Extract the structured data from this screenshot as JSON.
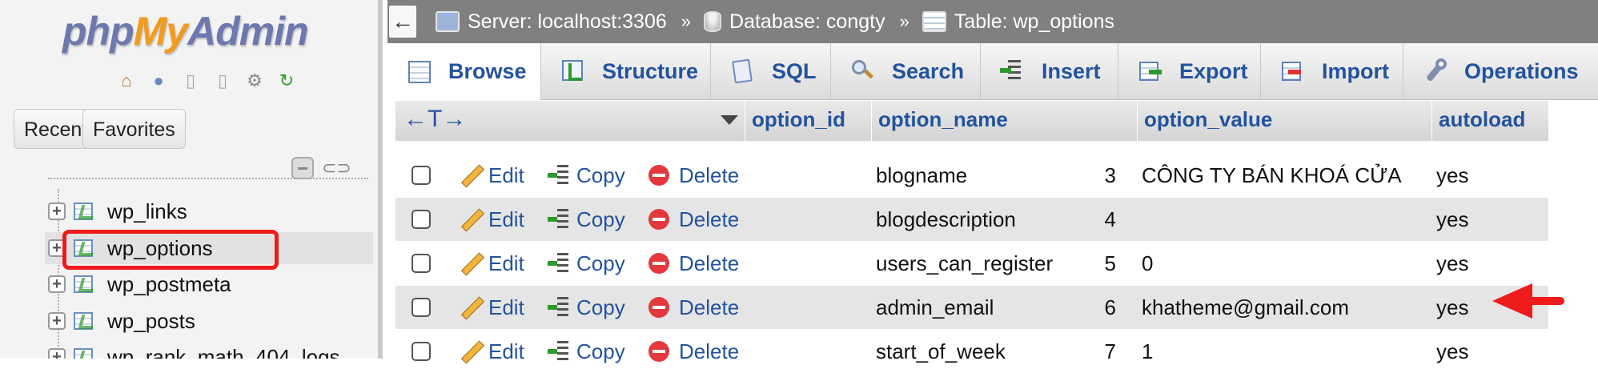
{
  "nav": {
    "logo_php": "php",
    "logo_my": "My",
    "logo_admin": "Admin",
    "recent_label": "Recent",
    "favorites_label": "Favorites",
    "tables": [
      {
        "label": "wp_links"
      },
      {
        "label": "wp_options",
        "selected": true
      },
      {
        "label": "wp_postmeta"
      },
      {
        "label": "wp_posts"
      },
      {
        "label": "wp_rank_math_404_logs"
      }
    ]
  },
  "breadcrumb": {
    "back": "←",
    "server": "Server: localhost:3306",
    "database": "Database: congty",
    "table": "Table: wp_options",
    "sep": "»"
  },
  "tabs": [
    "Browse",
    "Structure",
    "SQL",
    "Search",
    "Insert",
    "Export",
    "Import",
    "Operations"
  ],
  "grid": {
    "arrows": "←T→",
    "columns": [
      "option_id",
      "option_name",
      "option_value",
      "autoload"
    ],
    "actions": {
      "edit": "Edit",
      "copy": "Copy",
      "delete": "Delete"
    },
    "rows": [
      {
        "option_id": "3",
        "option_name": "blogname",
        "option_value": "CÔNG TY BÁN KHOÁ CỬA",
        "autoload": "yes"
      },
      {
        "option_id": "4",
        "option_name": "blogdescription",
        "option_value": "",
        "autoload": "yes"
      },
      {
        "option_id": "5",
        "option_name": "users_can_register",
        "option_value": "0",
        "autoload": "yes"
      },
      {
        "option_id": "6",
        "option_name": "admin_email",
        "option_value": "khatheme@gmail.com",
        "autoload": "yes"
      },
      {
        "option_id": "7",
        "option_name": "start_of_week",
        "option_value": "1",
        "autoload": "yes"
      }
    ]
  },
  "colors": {
    "link_blue": "#23539e",
    "highlight_red": "#ee1b1b",
    "topbar_gray": "#808080"
  }
}
